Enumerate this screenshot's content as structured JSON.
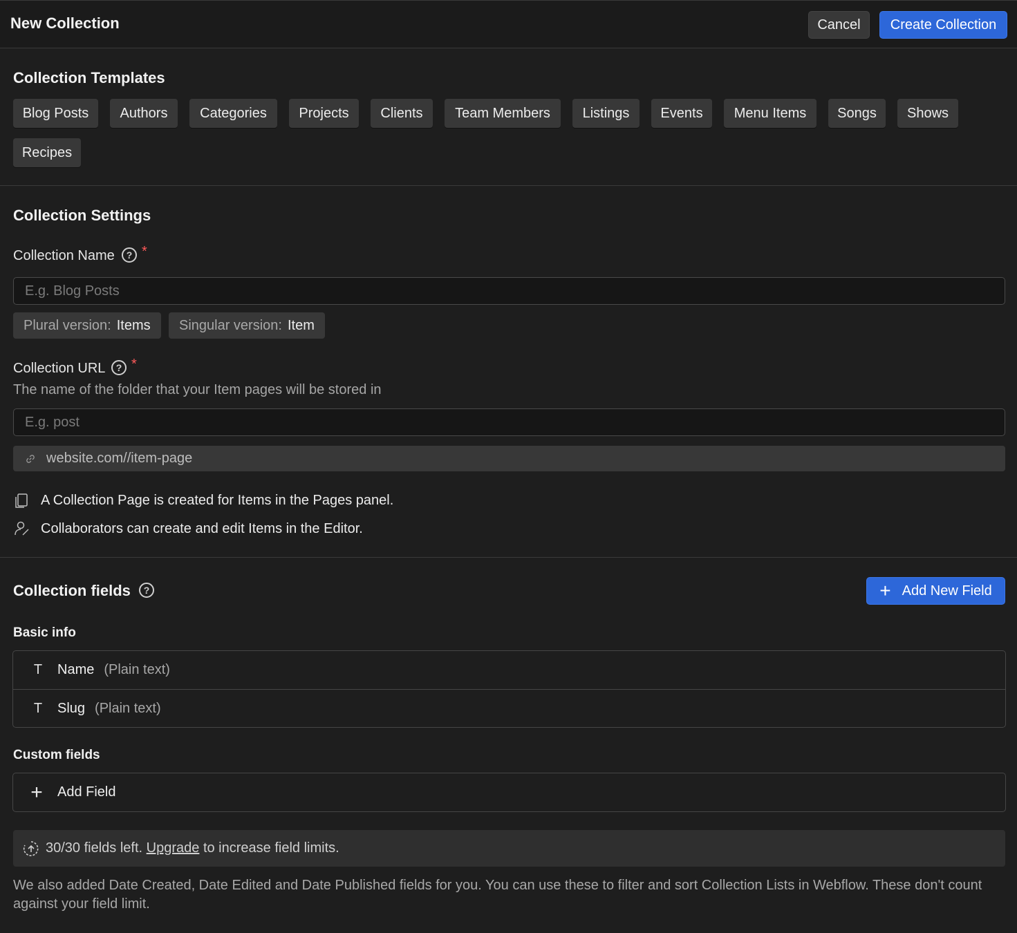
{
  "header": {
    "title": "New Collection",
    "cancel_label": "Cancel",
    "create_label": "Create Collection"
  },
  "templates": {
    "title": "Collection Templates",
    "items": [
      "Blog Posts",
      "Authors",
      "Categories",
      "Projects",
      "Clients",
      "Team Members",
      "Listings",
      "Events",
      "Menu Items",
      "Songs",
      "Shows",
      "Recipes"
    ]
  },
  "settings": {
    "title": "Collection Settings",
    "name_label": "Collection Name",
    "name_placeholder": "E.g. Blog Posts",
    "plural_label": "Plural version:",
    "plural_value": "Items",
    "singular_label": "Singular version:",
    "singular_value": "Item",
    "url_label": "Collection URL",
    "url_description": "The name of the folder that your Item pages will be stored in",
    "url_placeholder": "E.g. post",
    "url_preview": "website.com//item-page",
    "info_page": "A Collection Page is created for Items in the Pages panel.",
    "info_editor": "Collaborators can create and edit Items in the Editor.",
    "required_mark": "*",
    "help_mark": "?"
  },
  "fields": {
    "title": "Collection fields",
    "add_new_label": "Add New Field",
    "basic_title": "Basic info",
    "basic": [
      {
        "icon": "T",
        "name": "Name",
        "type": "(Plain text)"
      },
      {
        "icon": "T",
        "name": "Slug",
        "type": "(Plain text)"
      }
    ],
    "custom_title": "Custom fields",
    "add_field_label": "Add Field",
    "limit_prefix": "30/30 fields left.",
    "limit_link": "Upgrade",
    "limit_suffix": "to increase field limits.",
    "footnote": "We also added Date Created, Date Edited and Date Published fields for you. You can use these to filter and sort Collection Lists in Webflow. These don't count against your field limit."
  },
  "colors": {
    "primary": "#2d67d9",
    "background": "#1e1e1e",
    "chip": "#383838",
    "required": "#ff5a5a"
  }
}
